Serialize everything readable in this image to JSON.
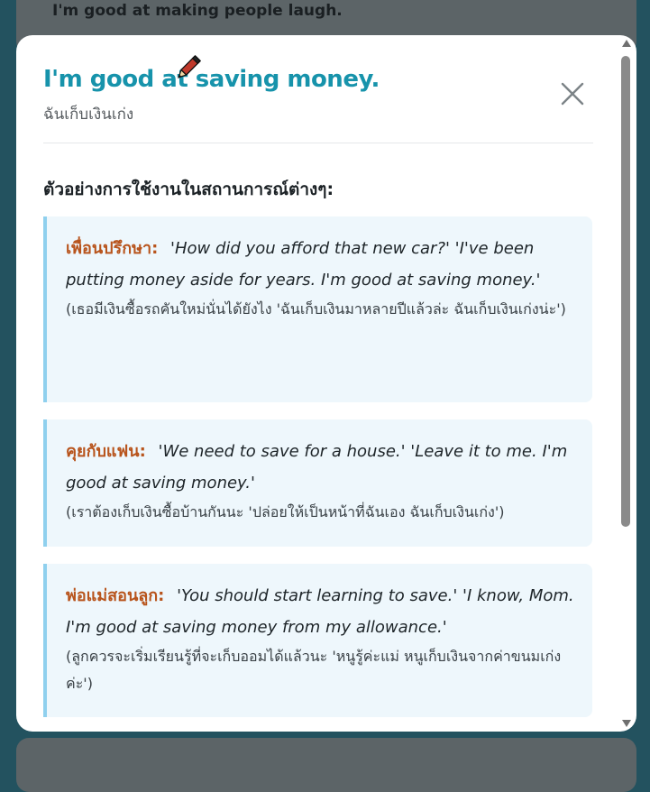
{
  "background": {
    "behind_text": "I'm good at making people laugh."
  },
  "modal": {
    "title": "I'm good at saving money.",
    "subtitle": "ฉันเก็บเงินเก่ง",
    "close_icon": "close-x-icon",
    "section_heading": "ตัวอย่างการใช้งานในสถานการณ์ต่างๆ:",
    "examples": [
      {
        "speaker": "เพื่อนปรึกษา:",
        "english": "'How did you afford that new car?' 'I've been putting money aside for years. I'm good at saving money.'",
        "thai": "(เธอมีเงินซื้อรถคันใหม่นั่นได้ยังไง 'ฉันเก็บเงินมาหลายปีแล้วล่ะ ฉันเก็บเงินเก่งน่ะ')"
      },
      {
        "speaker": "คุยกับแฟน:",
        "english": "'We need to save for a house.' 'Leave it to me. I'm good at saving money.'",
        "thai": "(เราต้องเก็บเงินซื้อบ้านกันนะ 'ปล่อยให้เป็นหน้าที่ฉันเอง ฉันเก็บเงินเก่ง')"
      },
      {
        "speaker": "พ่อแม่สอนลูก:",
        "english": "'You should start learning to save.' 'I know, Mom. I'm good at saving money from my allowance.'",
        "thai": "(ลูกควรจะเริ่มเรียนรู้ที่จะเก็บออมได้แล้วนะ 'หนูรู้ค่ะแม่ หนูเก็บเงินจากค่าขนมเก่งค่ะ')"
      }
    ]
  },
  "colors": {
    "title": "#1793ab",
    "speaker": "#b8541c",
    "example_bg": "#eef7fc",
    "example_border": "#8fd0ee"
  }
}
